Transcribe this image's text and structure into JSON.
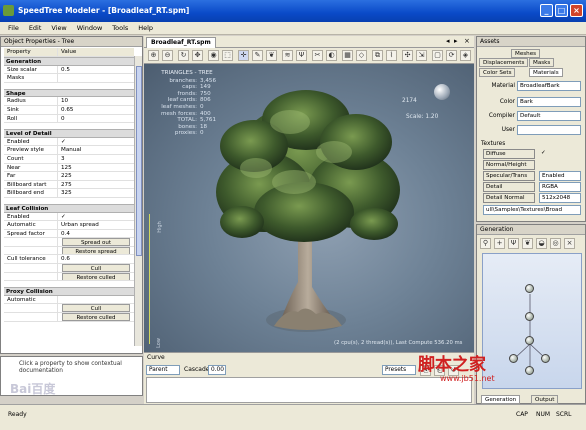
{
  "window": {
    "title": "SpeedTree Modeler - [Broadleaf_RT.spm]",
    "minimize": "_",
    "maximize": "□",
    "close": "×"
  },
  "menu": [
    "File",
    "Edit",
    "View",
    "Window",
    "Tools",
    "Help"
  ],
  "left_panel": {
    "title": "Object Properties - Tree",
    "col_property": "Property",
    "col_value": "Value",
    "rows": [
      {
        "type": "sec",
        "k": "Generation"
      },
      {
        "type": "kv",
        "k": "Size scalar",
        "v": "0.5"
      },
      {
        "type": "kv",
        "k": "Masks",
        "v": ""
      },
      {
        "type": "gap"
      },
      {
        "type": "sec",
        "k": "Shape"
      },
      {
        "type": "kv",
        "k": "Radius",
        "v": "10"
      },
      {
        "type": "kv",
        "k": "Sink",
        "v": "0.65"
      },
      {
        "type": "kv",
        "k": "Roll",
        "v": "0"
      },
      {
        "type": "gap"
      },
      {
        "type": "sec",
        "k": "Level of Detail"
      },
      {
        "type": "kv",
        "k": "Enabled",
        "v": "✓"
      },
      {
        "type": "kv",
        "k": "Preview style",
        "v": "Manual"
      },
      {
        "type": "kv",
        "k": "Count",
        "v": "3"
      },
      {
        "type": "kv",
        "k": "Near",
        "v": "125"
      },
      {
        "type": "kv",
        "k": "Far",
        "v": "225"
      },
      {
        "type": "kv",
        "k": "Billboard start",
        "v": "275"
      },
      {
        "type": "kv",
        "k": "Billboard end",
        "v": "325"
      },
      {
        "type": "gap"
      },
      {
        "type": "sec",
        "k": "Leaf Collision"
      },
      {
        "type": "kv",
        "k": "Enabled",
        "v": "✓"
      },
      {
        "type": "kv",
        "k": "Automatic",
        "v": "Urban spread"
      },
      {
        "type": "kv",
        "k": "Spread factor",
        "v": "0.4"
      },
      {
        "type": "btn",
        "v": "Spread out"
      },
      {
        "type": "btn",
        "v": "Restore spread"
      },
      {
        "type": "kv",
        "k": "Cull tolerance",
        "v": "0.6"
      },
      {
        "type": "btn",
        "v": "Cull"
      },
      {
        "type": "btn",
        "v": "Restore culled"
      },
      {
        "type": "gap"
      },
      {
        "type": "sec",
        "k": "Proxy Collision"
      },
      {
        "type": "kv",
        "k": "Automatic",
        "v": ""
      },
      {
        "type": "btn",
        "v": "Cull"
      },
      {
        "type": "btn",
        "v": "Restore culled"
      }
    ],
    "help_text": "Click a property to show contextual documentation"
  },
  "viewport": {
    "tab": "Broadleaf_RT.spm",
    "stats_title": "TRIANGLES - TREE",
    "stats": [
      {
        "k": "branches:",
        "v": "3,456"
      },
      {
        "k": "caps:",
        "v": "149"
      },
      {
        "k": "fronds:",
        "v": "750"
      },
      {
        "k": "leaf cards:",
        "v": "806"
      },
      {
        "k": "leaf meshes:",
        "v": "0"
      },
      {
        "k": "mesh forces:",
        "v": "400"
      },
      {
        "k": "TOTAL:",
        "v": "5,761"
      },
      {
        "k": "",
        "v": ""
      },
      {
        "k": "bones:",
        "v": "18"
      },
      {
        "k": "proxies:",
        "v": "0"
      }
    ],
    "counter": "2174",
    "scale": "Scale: 1.20",
    "high_label": "High",
    "low_label": "Low",
    "compute": "(2 cpu(s), 2 thread(s)), Last Compute 536.20 ms"
  },
  "curve_panel": {
    "title": "Curve",
    "parent_value": "Parent",
    "cascade_label": "Cascade",
    "cascade_value": "0.00",
    "preset_label": "Presets"
  },
  "assets": {
    "title": "Assets",
    "tab_meshes": "Meshes",
    "tab_displacements": "Displacements",
    "tab_masks": "Masks",
    "tab_color_sets": "Color Sets",
    "tab_materials": "Materials",
    "material_label": "Material",
    "material_value": "BroadleafBark",
    "color_label": "Color",
    "color_value": "Bark",
    "compiler_label": "Compiler",
    "compiler_value": "Default",
    "user_label": "User",
    "user_value": "",
    "textures_label": "Textures",
    "diffuse_label": "Diffuse",
    "diffuse_value": "✓",
    "normal_label": "Normal/Height",
    "specular_label": "Specular/Trans",
    "specular_value": "Enabled",
    "detail_label": "Detail",
    "detail_value": "RGBA",
    "detail_normal_label": "Detail Normal",
    "detail_normal_value": "512x2048",
    "path_value": "ull\\Samples\\Textures\\Broad"
  },
  "generation": {
    "title": "Generation",
    "tab_generation": "Generation",
    "tab_output": "Output"
  },
  "status": {
    "text": "Ready",
    "caps": "CAP",
    "num": "NUM",
    "scrl": "SCRL"
  },
  "watermark": {
    "cn": "脚本之家",
    "url": "www.jb51.net"
  },
  "baidu": "Bai百度"
}
